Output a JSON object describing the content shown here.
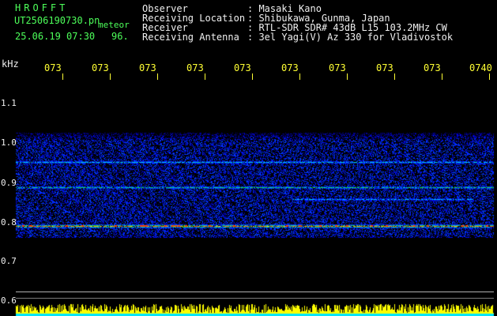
{
  "header": {
    "brand": "HROFFT",
    "filename": "UT2506190730.pn",
    "file_ext": "meteor",
    "datetime": "25.06.19 07:30",
    "count": "96."
  },
  "info": [
    {
      "label": "Observer",
      "value": ": Masaki Kano"
    },
    {
      "label": "Receiving Location",
      "value": ": Shibukawa, Gunma, Japan"
    },
    {
      "label": "Receiver",
      "value": ": RTL-SDR SDR# 43dB L15 103.2MHz CW"
    },
    {
      "label": "Receiving Antenna",
      "value": ": 3el Yagi(V) Az 330 for Vladivostok"
    }
  ],
  "axis": {
    "unit": "kHz",
    "y_ticks": [
      "1.1",
      "1.0",
      "0.9",
      "0.8",
      "0.7",
      "0.6"
    ]
  },
  "time_marks": [
    "073",
    "073",
    "073",
    "073",
    "073",
    "073",
    "073",
    "073",
    "073",
    "0740"
  ],
  "colors": {
    "header_green": "#4dff5a",
    "timeline_yellow": "#ffff33",
    "background": "#000000",
    "noise_blue": "#1a30ff"
  }
}
